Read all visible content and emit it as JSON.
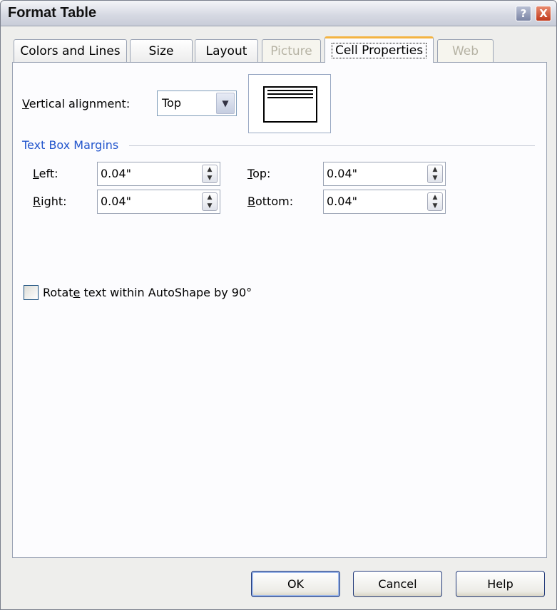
{
  "window": {
    "title": "Format Table",
    "help_icon": "?",
    "close_icon": "X"
  },
  "tabs": [
    {
      "label": "Colors and Lines",
      "state": "normal"
    },
    {
      "label": "Size",
      "state": "normal"
    },
    {
      "label": "Layout",
      "state": "normal"
    },
    {
      "label": "Picture",
      "state": "disabled"
    },
    {
      "label": "Cell Properties",
      "state": "active"
    },
    {
      "label": "Web",
      "state": "disabled"
    }
  ],
  "cell_properties": {
    "vertical_alignment": {
      "label_accel": "V",
      "label_rest": "ertical alignment:",
      "value": "Top"
    },
    "margins": {
      "group_label": "Text Box Margins",
      "left": {
        "label_accel": "L",
        "label_rest": "eft:",
        "value": "0.04\""
      },
      "right": {
        "label_accel": "R",
        "label_rest": "ight:",
        "value": "0.04\""
      },
      "top": {
        "label_accel": "T",
        "label_rest": "op:",
        "value": "0.04\""
      },
      "bottom": {
        "label_accel": "B",
        "label_rest": "ottom:",
        "value": "0.04\""
      }
    },
    "rotate": {
      "label_pre": "Rotat",
      "label_accel": "e",
      "label_post": " text within AutoShape by 90°",
      "checked": false
    }
  },
  "buttons": {
    "ok": "OK",
    "cancel": "Cancel",
    "help": "Help"
  },
  "colors": {
    "group_label": "#2255cc",
    "active_tab_accent": "#f4b442"
  }
}
